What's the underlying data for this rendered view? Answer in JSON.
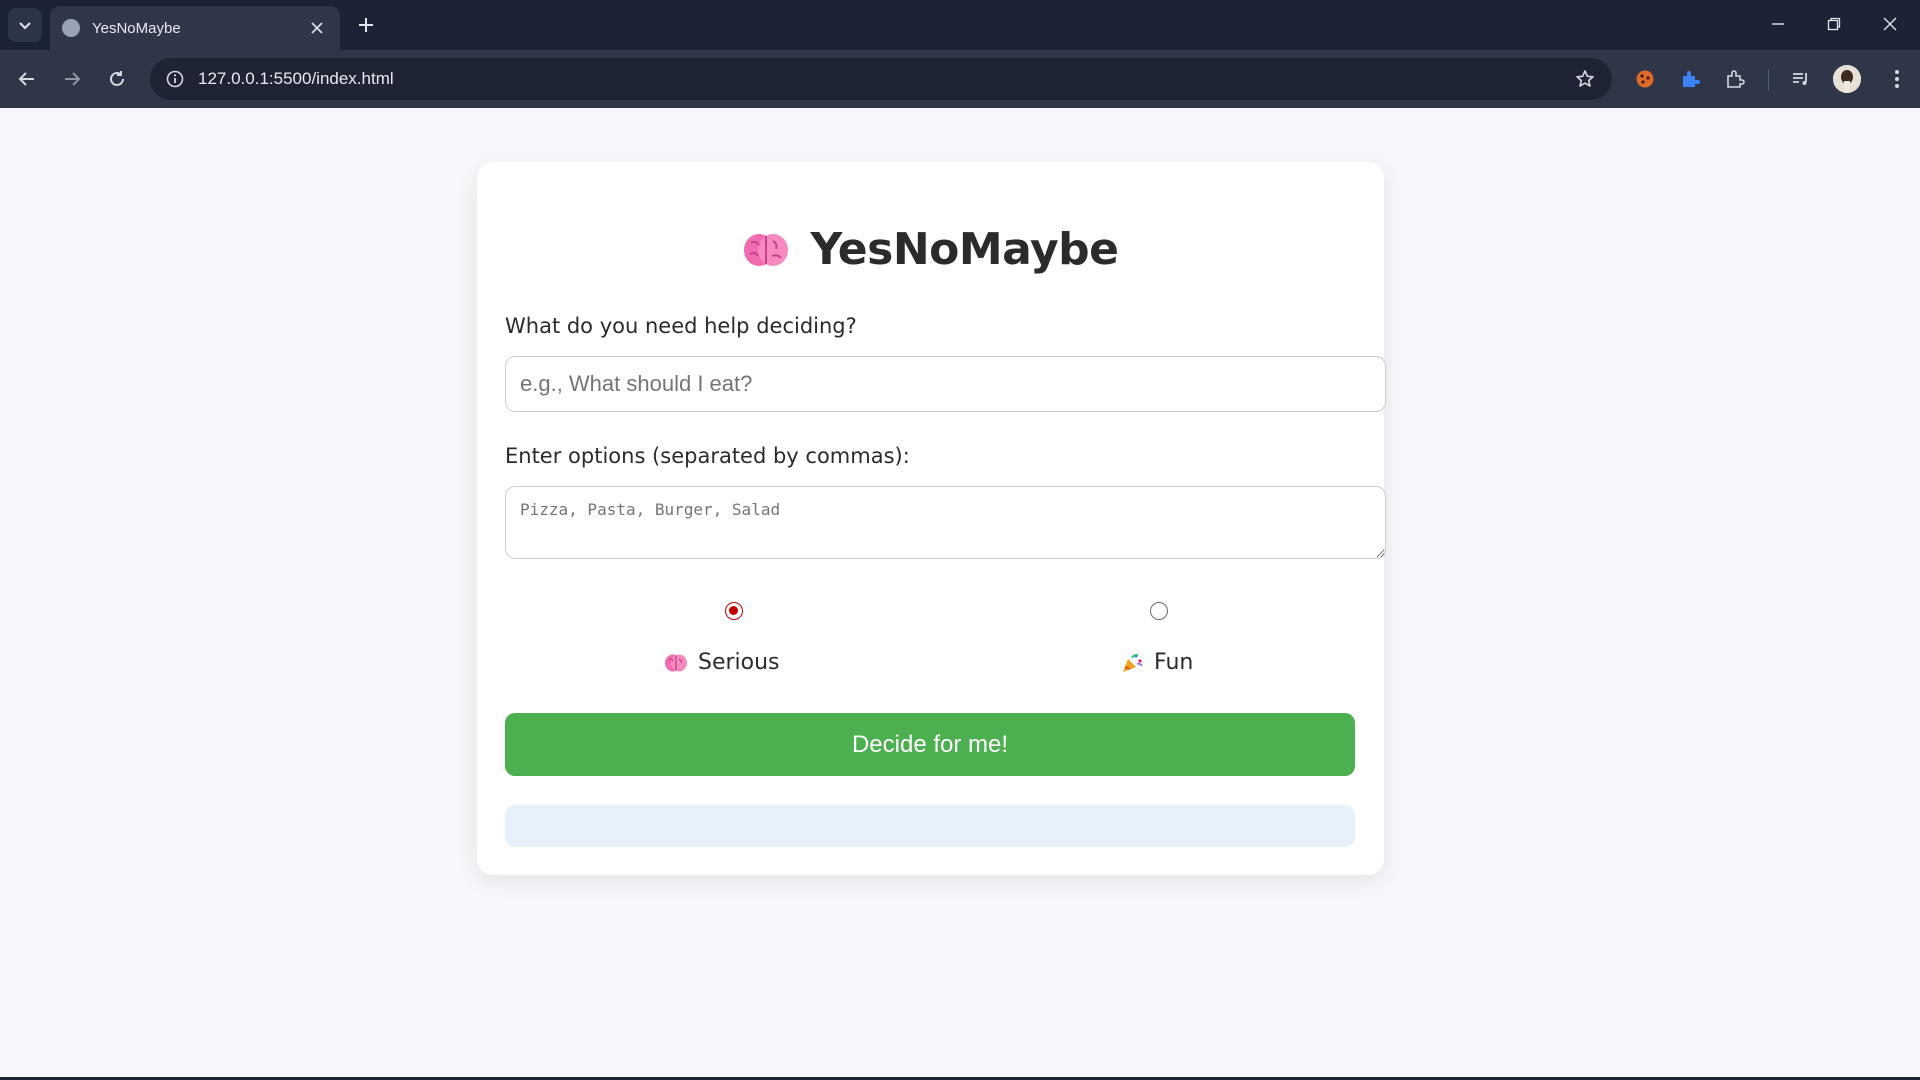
{
  "browser": {
    "tab_title": "YesNoMaybe",
    "url": "127.0.0.1:5500/index.html",
    "icons": {
      "tab_search": "chevron-down-icon",
      "tab_favicon": "globe-icon",
      "tab_close": "close-icon",
      "new_tab": "plus-icon",
      "back": "back-arrow-icon",
      "forward": "forward-arrow-icon",
      "reload": "reload-icon",
      "site_info": "info-icon",
      "bookmark": "star-icon",
      "extensions": [
        "cookie-extension-icon",
        "puzzle-extension-icon",
        "extensions-icon"
      ],
      "media": "media-control-icon",
      "profile": "avatar",
      "menu": "kebab-menu-icon"
    }
  },
  "app": {
    "title": "YesNoMaybe",
    "title_icon": "brain-icon",
    "question_label": "What do you need help deciding?",
    "question_placeholder": "e.g., What should I eat?",
    "options_label": "Enter options (separated by commas):",
    "options_placeholder": "Pizza, Pasta, Burger, Salad",
    "modes": [
      {
        "label": "Serious",
        "icon": "brain-icon",
        "selected": true
      },
      {
        "label": "Fun",
        "icon": "party-popper-icon",
        "selected": false
      }
    ],
    "decide_button": "Decide for me!",
    "result": ""
  },
  "colors": {
    "button": "#4caf50",
    "result_bg": "#e6f1fc",
    "radio_selected": "#c00000",
    "page_bg": "#f6f7fb",
    "chrome_dark": "#1b2233",
    "chrome_toolbar": "#2f3647"
  }
}
